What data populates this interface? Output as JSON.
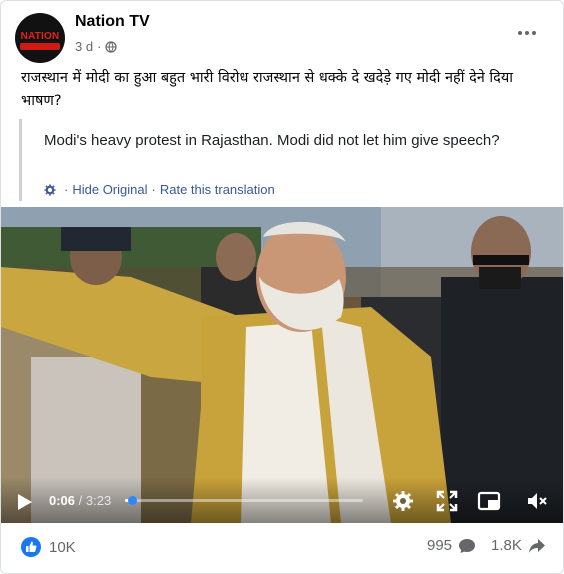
{
  "post": {
    "page_name": "Nation TV",
    "time_ago": "3 d",
    "dot": "·",
    "avatar_text": "NATION",
    "text_hindi": "राजस्थान में मोदी का हुआ बहुत भारी विरोध राजस्थान से धक्के दे खदेड़े गए मोदी नहीं देने दिया भाषण?"
  },
  "translation": {
    "text": "Modi's heavy protest in Rajasthan. Modi did not let him give speech?",
    "sep1": "·",
    "hide_label": "Hide Original",
    "sep2": "·",
    "rate_label": "Rate this translation"
  },
  "video": {
    "current_time": "0:06",
    "duration": " / 3:23",
    "progress_fraction": 0.03
  },
  "reactions": {
    "likes": "10K",
    "comments": "995",
    "shares": "1.8K"
  },
  "colors": {
    "link": "#385898",
    "like_blue": "#1877f2",
    "progress_knob": "#2d88ff"
  },
  "icons": [
    "globe-icon",
    "more-icon",
    "gear-icon",
    "play-icon",
    "settings-icon",
    "fullscreen-icon",
    "miniplayer-icon",
    "mute-icon",
    "like-icon",
    "comment-icon",
    "share-icon"
  ]
}
